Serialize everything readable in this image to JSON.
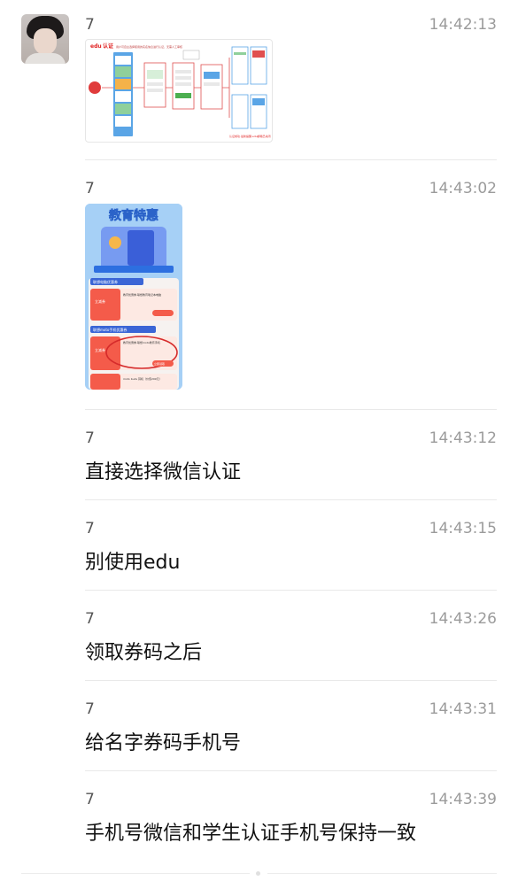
{
  "messages": [
    {
      "sender": "7",
      "time": "14:42:13",
      "image": {
        "title": "edu",
        "title2": "认证",
        "subtitle": "用户可自主选择使用的实名信息进行认证，无需人工审核",
        "footer": "认证成功·最新提醒·edu邮箱已关闭"
      }
    },
    {
      "sender": "7",
      "time": "14:43:02",
      "image": {
        "banner": "教育特惠",
        "section1": "联想电脑优惠券",
        "section2": "联想moto手机优惠券",
        "coupon_left": "立减券",
        "coupon1_text": "教育优惠券·联想教育笔记本电脑",
        "coupon2_text": "教育优惠券·联想moto教育手机",
        "coupon3_text": "moto buds 耳机（价值299元）",
        "btn": "立即领取"
      }
    },
    {
      "sender": "7",
      "time": "14:43:12",
      "text": "直接选择微信认证"
    },
    {
      "sender": "7",
      "time": "14:43:15",
      "text": "别使用edu"
    },
    {
      "sender": "7",
      "time": "14:43:26",
      "text": "领取券码之后"
    },
    {
      "sender": "7",
      "time": "14:43:31",
      "text": "给名字券码手机号"
    },
    {
      "sender": "7",
      "time": "14:43:39",
      "text": "手机号微信和学生认证手机号保持一致"
    }
  ]
}
